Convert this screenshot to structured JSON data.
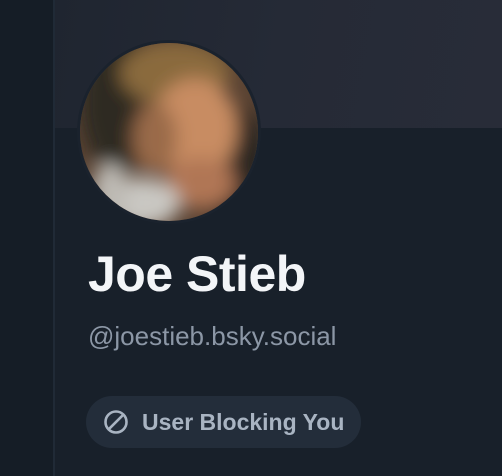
{
  "profile": {
    "display_name": "Joe Stieb",
    "handle": "@joestieb.bsky.social",
    "avatar_icon": "user-avatar-photo",
    "block_badge": {
      "icon": "block-icon",
      "label": "User Blocking You"
    }
  },
  "colors": {
    "background": "#161e27",
    "banner": "#252a36",
    "name_text": "#f3f5f8",
    "handle_text": "#8c97a6",
    "badge_bg": "#232d3a",
    "badge_text": "#a9b4c2"
  }
}
